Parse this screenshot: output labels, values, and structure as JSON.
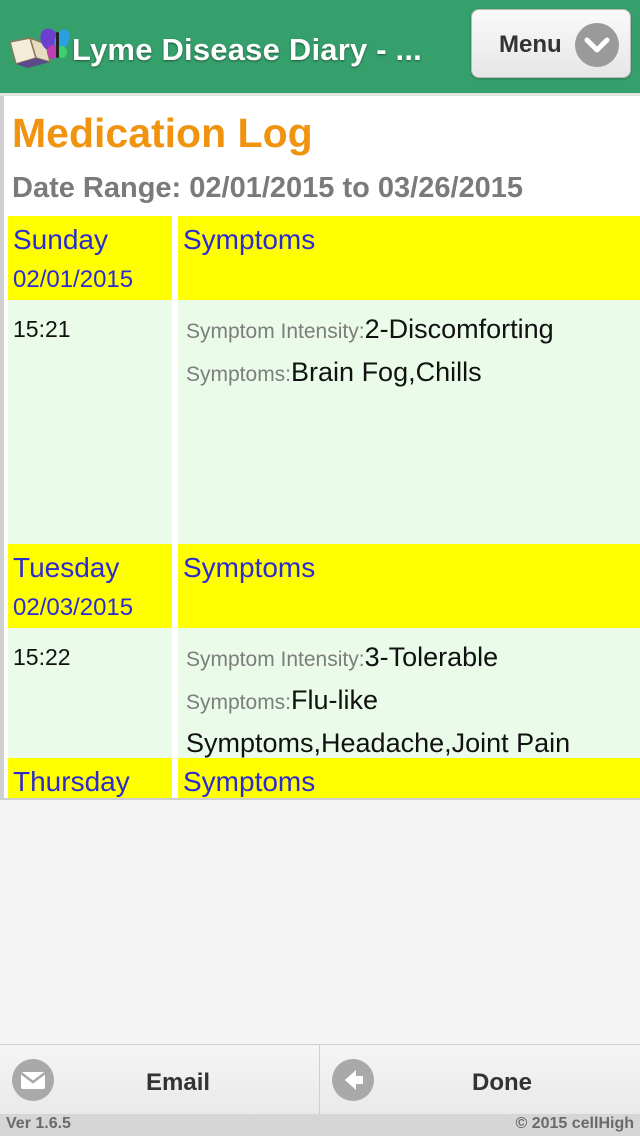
{
  "header": {
    "app_title": "Lyme Disease Diary - ...",
    "menu_label": "Menu",
    "app_icon": "butterfly-book-icon",
    "menu_icon": "chevron-down-icon",
    "bar_color": "#35a06b"
  },
  "page": {
    "title": "Medication Log",
    "date_range": "Date Range: 02/01/2015 to 03/26/2015"
  },
  "entries": [
    {
      "day": "Sunday",
      "date": "02/01/2015",
      "type": "Symptoms",
      "time": "15:21",
      "intensity_label": "Symptom Intensity:",
      "intensity_value": "2-Discomforting",
      "symptoms_label": "Symptoms:",
      "symptoms_value": "Brain Fog,Chills"
    },
    {
      "day": "Tuesday",
      "date": "02/03/2015",
      "type": "Symptoms",
      "time": "15:22",
      "intensity_label": "Symptom Intensity:",
      "intensity_value": "3-Tolerable",
      "symptoms_label": "Symptoms:",
      "symptoms_value": "Flu-like Symptoms,Headache,Joint Pain"
    },
    {
      "day": "Thursday",
      "type": "Symptoms"
    }
  ],
  "bottom_bar": {
    "email_label": "Email",
    "email_icon": "envelope-icon",
    "done_label": "Done",
    "done_icon": "arrow-left-icon"
  },
  "footer": {
    "version": "Ver 1.6.5",
    "copyright": "© 2015 cellHigh"
  },
  "colors": {
    "header_green": "#35a06b",
    "title_orange": "#f0930f",
    "day_header_yellow": "#ffff00",
    "day_text_blue": "#2b2bd0",
    "row_green": "#eafbea"
  }
}
